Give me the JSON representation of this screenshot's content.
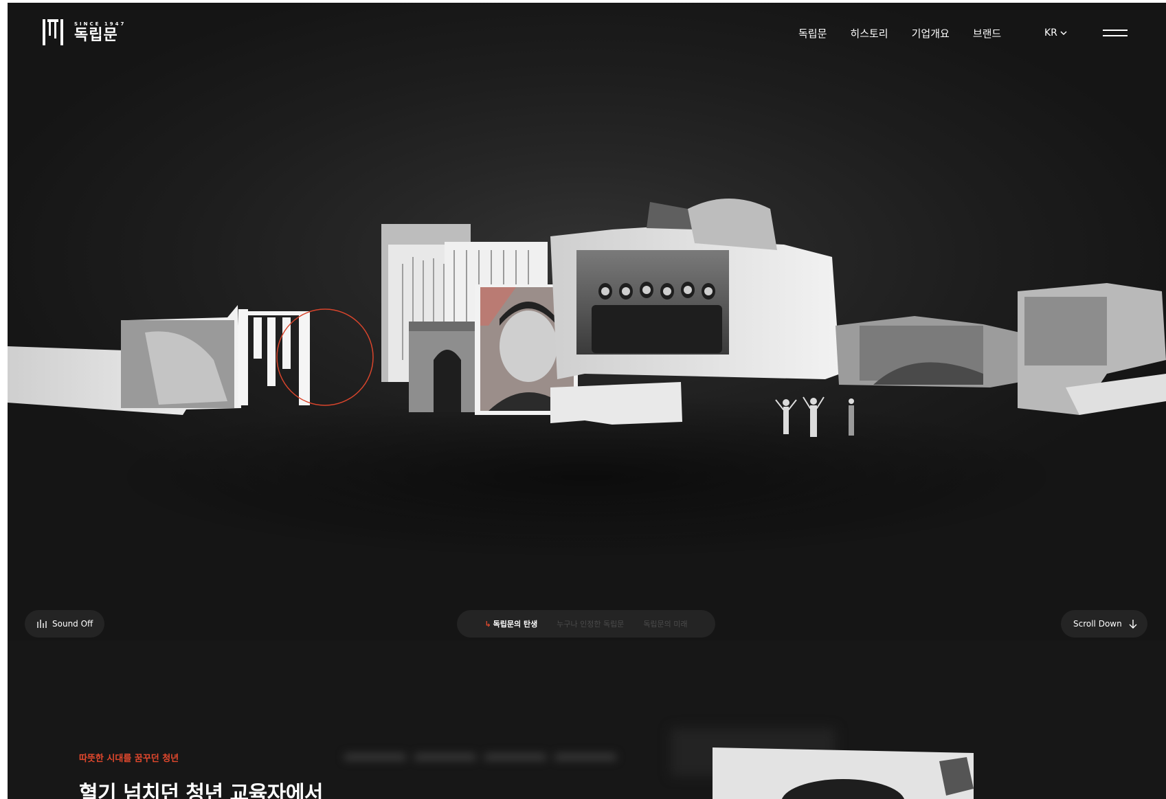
{
  "brand": {
    "since": "SINCE 1947",
    "name": "독립문",
    "logo_icon": "brand-bars-icon"
  },
  "nav": {
    "items": [
      {
        "label": "독립문"
      },
      {
        "label": "히스토리"
      },
      {
        "label": "기업개요"
      },
      {
        "label": "브랜드"
      }
    ],
    "language": "KR",
    "menu_icon": "hamburger-icon"
  },
  "hero": {
    "collage_description_icons": [
      "archive-document-icon",
      "portrait-photo-icon",
      "group-photo-icon",
      "people-silhouette-icon"
    ]
  },
  "controls": {
    "sound_label": "Sound Off",
    "sound_icon": "sound-bars-icon",
    "chapters": [
      {
        "label": "독립문의 탄생",
        "active": true
      },
      {
        "label": "누구나 인정한 독립문",
        "active": false
      },
      {
        "label": "독립문의 미래",
        "active": false
      }
    ],
    "scroll_label": "Scroll Down",
    "scroll_icon": "arrow-down-icon"
  },
  "section": {
    "kicker": "따뜻한 시대를 꿈꾸던 청년",
    "headline": "혈기 넘치던 청년 교육자에서"
  },
  "colors": {
    "background": "#161616",
    "accent": "#e3482d",
    "text": "#ffffff",
    "muted": "#4b4b4b"
  }
}
